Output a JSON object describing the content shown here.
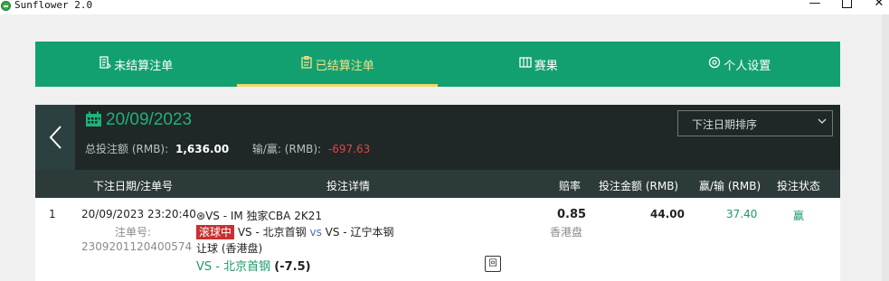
{
  "window": {
    "title": "Sunflower 2.0",
    "minimize": "—",
    "close": "✕"
  },
  "nav": {
    "tabs": [
      {
        "label": "未结算注单",
        "icon": "document-icon"
      },
      {
        "label": "已结算注单",
        "icon": "clipboard-icon",
        "active": true
      },
      {
        "label": "赛果",
        "icon": "scoreboard-icon"
      },
      {
        "label": "个人设置",
        "icon": "gear-icon"
      }
    ]
  },
  "header": {
    "date": "20/09/2023",
    "total_label": "总投注额 (RMB):",
    "total_value": "1,636.00",
    "winloss_label": "输/赢: (RMB):",
    "winloss_value": "-697.63",
    "sort_label": "下注日期排序"
  },
  "table": {
    "columns": [
      "下注日期/注单号",
      "投注详情",
      "赔率",
      "投注金额 (RMB)",
      "赢/输 (RMB)",
      "投注状态"
    ],
    "rows": [
      {
        "index": "1",
        "datetime": "20/09/2023 23:20:40",
        "order_label": "注单号:",
        "order_no": "2309201120400574",
        "league": "VS - IM 独家CBA 2K21",
        "live_tag": "滚球中",
        "home": "VS - 北京首钢",
        "vs": "vs",
        "away": "VS - 辽宁本钢",
        "market": "让球 (香港盘)",
        "selection": "VS - 北京首钢",
        "handicap": "(-7.5)",
        "odds": "0.85",
        "odds_type": "香港盘",
        "stake": "44.00",
        "winloss": "37.40",
        "status": "赢",
        "rec_icon_text": "回"
      }
    ]
  },
  "colors": {
    "nav_green": "#13a070",
    "active_gold": "#f1d76a",
    "date_green": "#1fb27c",
    "negative_red": "#e0453f",
    "live_red": "#c8312f"
  }
}
